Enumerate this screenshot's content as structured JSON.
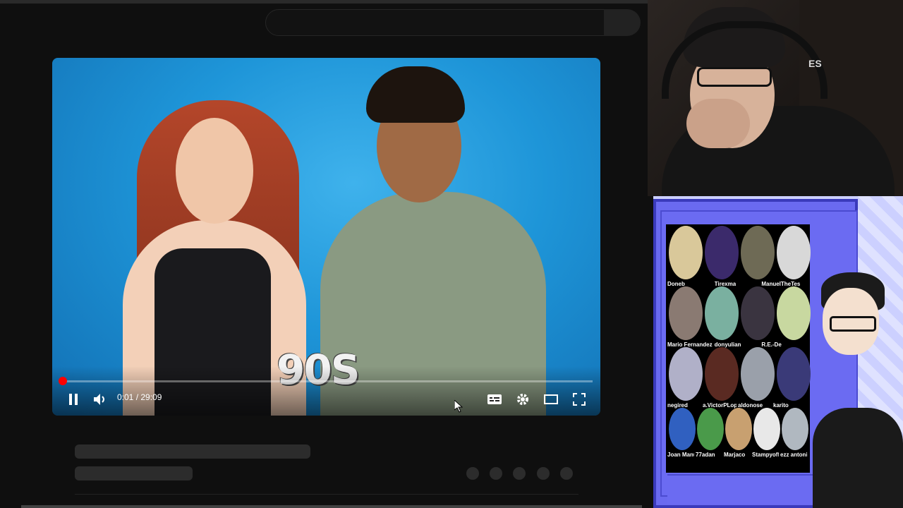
{
  "player": {
    "overlay_text": "90S",
    "time_display": "0:01 / 29:09",
    "progress_fraction": 0.0006,
    "accent_color": "#ff0000"
  },
  "icons": {
    "play_pause": "pause-icon",
    "volume": "volume-icon",
    "captions": "subtitles-icon",
    "settings": "gear-icon",
    "theater": "theater-mode-icon",
    "fullscreen": "fullscreen-icon"
  },
  "webcam": {
    "headset_text": "ES"
  },
  "chat_grid": {
    "labels": [
      "Doneb",
      "Tirexma",
      "ManuelTheTes",
      "Mario Fernandez",
      "donyulian",
      "R.E.-De",
      "negired",
      "a.VictorPLopez",
      "aldonose",
      "karito",
      "Joan Manuel",
      "77adan",
      "Marjaco",
      "Stampyoff",
      "ezz antonio morin"
    ]
  }
}
